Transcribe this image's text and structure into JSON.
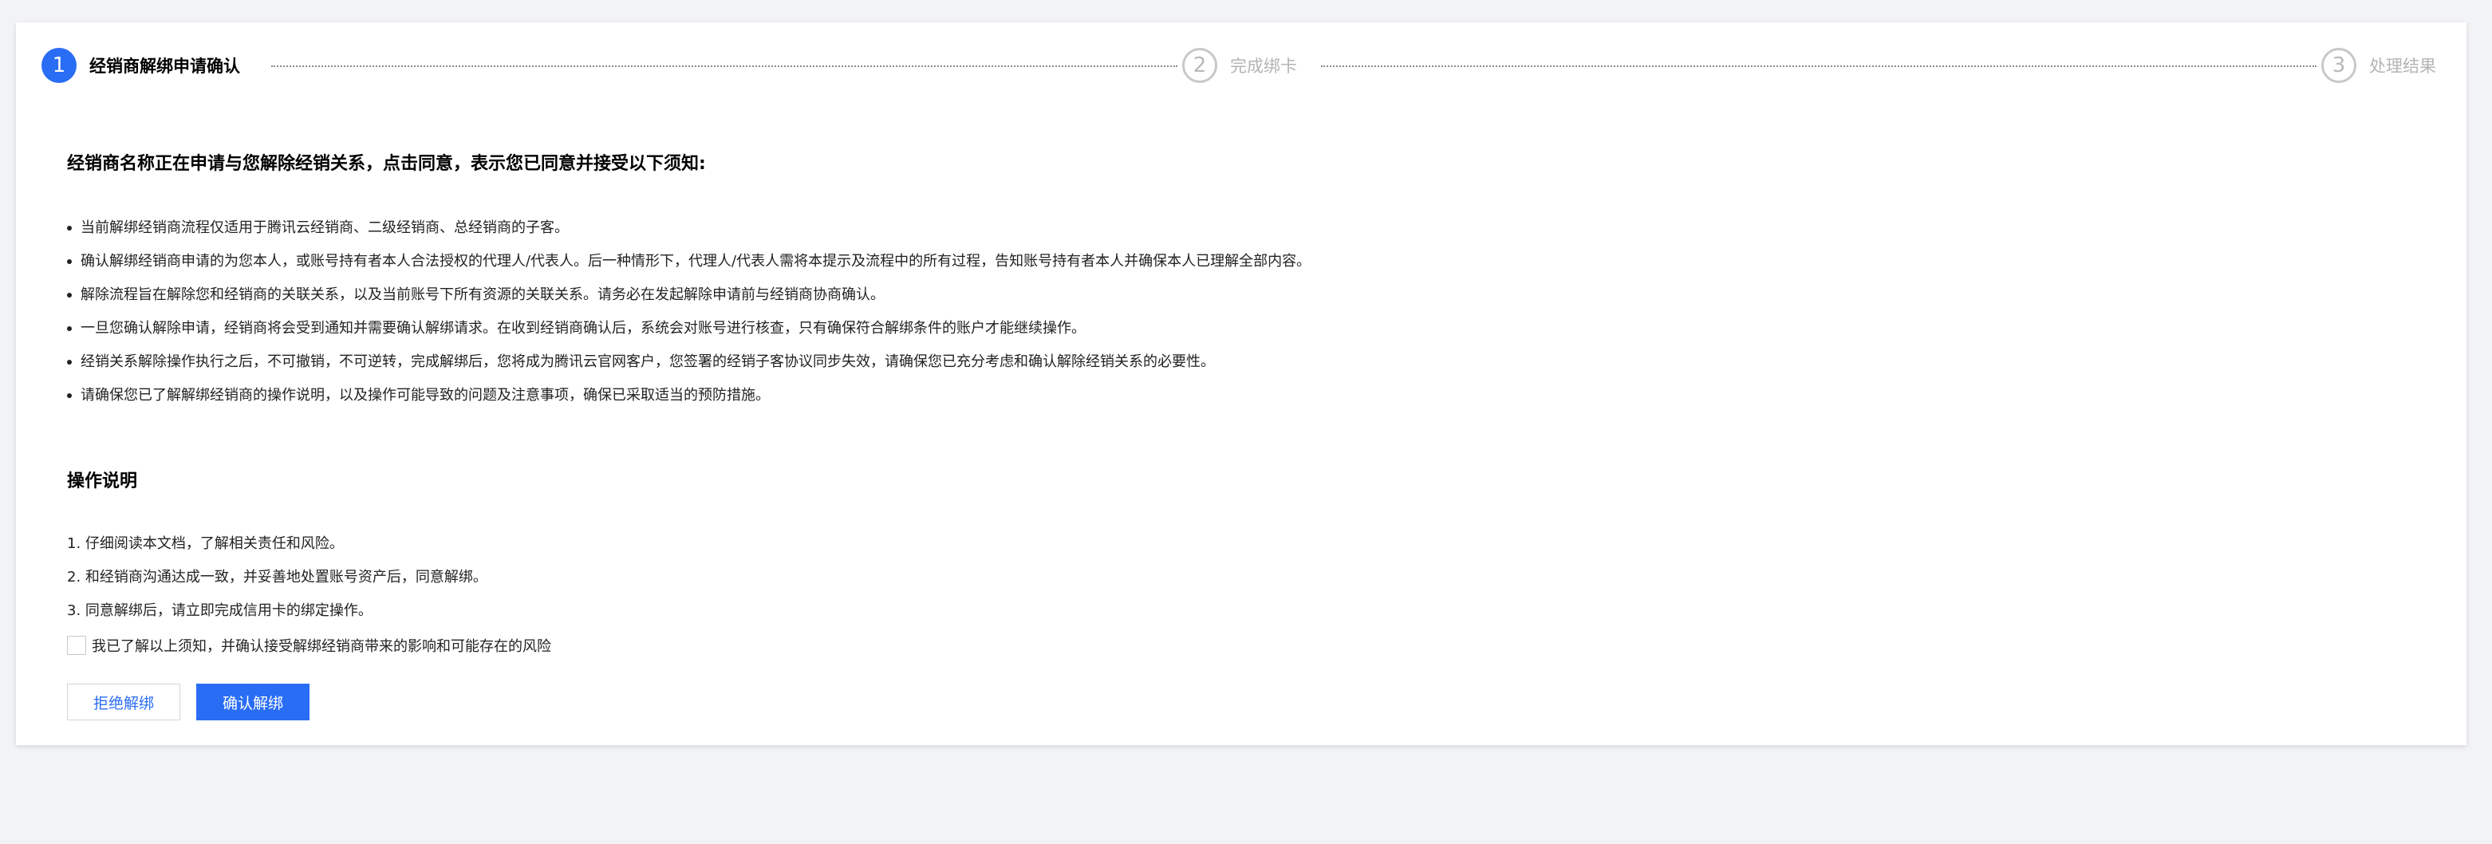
{
  "steps": [
    {
      "number": "1",
      "label": "经销商解绑申请确认",
      "state": "active"
    },
    {
      "number": "2",
      "label": "完成绑卡",
      "state": "inactive"
    },
    {
      "number": "3",
      "label": "处理结果",
      "state": "inactive"
    }
  ],
  "notice": {
    "title": "经销商名称正在申请与您解除经销关系，点击同意，表示您已同意并接受以下须知:",
    "items": [
      "当前解绑经销商流程仅适用于腾讯云经销商、二级经销商、总经销商的子客。",
      "确认解绑经销商申请的为您本人，或账号持有者本人合法授权的代理人/代表人。后一种情形下，代理人/代表人需将本提示及流程中的所有过程，告知账号持有者本人并确保本人已理解全部内容。",
      "解除流程旨在解除您和经销商的关联关系，以及当前账号下所有资源的关联关系。请务必在发起解除申请前与经销商协商确认。",
      "一旦您确认解除申请，经销商将会受到通知并需要确认解绑请求。在收到经销商确认后，系统会对账号进行核查，只有确保符合解绑条件的账户才能继续操作。",
      "经销关系解除操作执行之后，不可撤销，不可逆转，完成解绑后，您将成为腾讯云官网客户，您签署的经销子客协议同步失效，请确保您已充分考虑和确认解除经销关系的必要性。",
      "请确保您已了解解绑经销商的操作说明，以及操作可能导致的问题及注意事项，确保已采取适当的预防措施。"
    ]
  },
  "operations": {
    "title": "操作说明",
    "items": [
      "1. 仔细阅读本文档，了解相关责任和风险。",
      "2. 和经销商沟通达成一致，并妥善地处置账号资产后，同意解绑。",
      "3. 同意解绑后，请立即完成信用卡的绑定操作。"
    ]
  },
  "agreement": {
    "checked": false,
    "label": "我已了解以上须知，并确认接受解绑经销商带来的影响和可能存在的风险"
  },
  "buttons": {
    "reject": "拒绝解绑",
    "confirm": "确认解绑"
  },
  "colors": {
    "accent": "#2a6df5",
    "background": "#f2f3f5",
    "inactive_step": "#b4b4b4"
  }
}
